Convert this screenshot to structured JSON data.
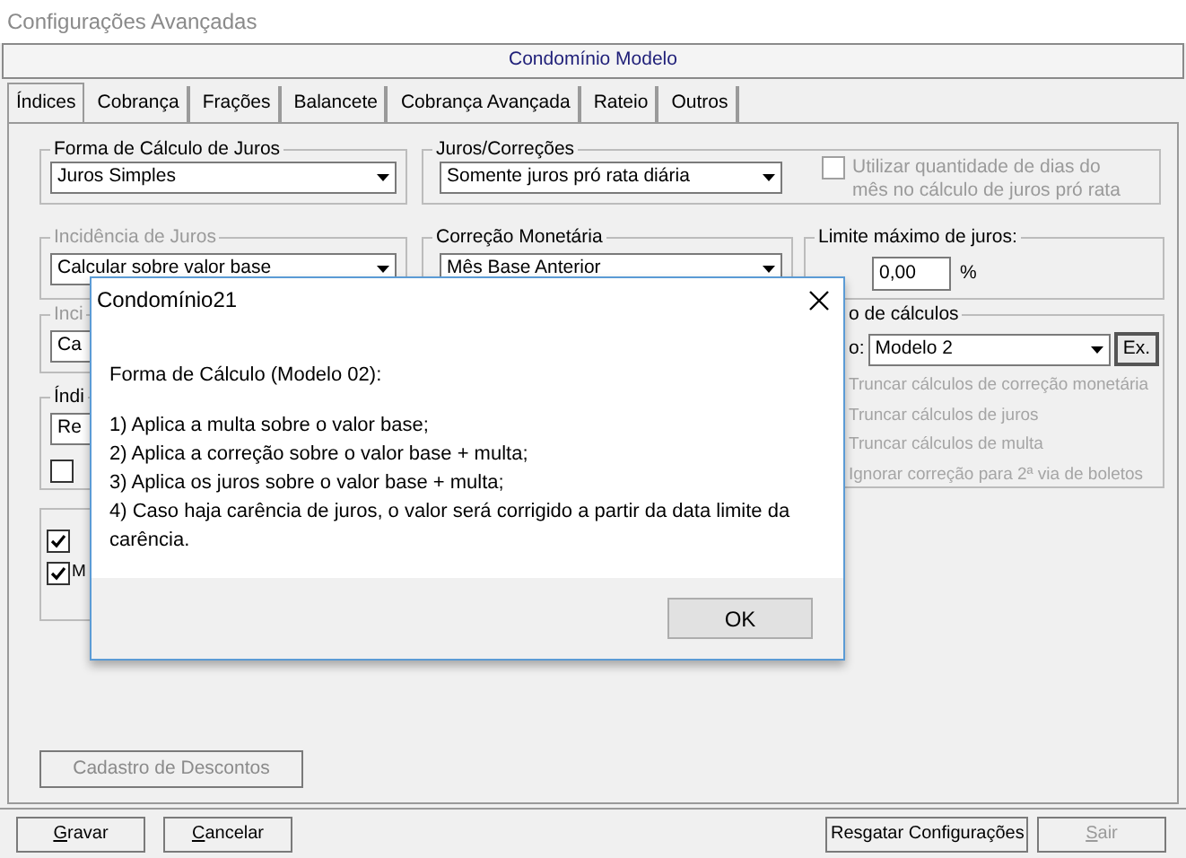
{
  "window": {
    "title": "Configurações Avançadas"
  },
  "header": {
    "title": "Condomínio Modelo"
  },
  "tabs": [
    {
      "label": "Índices",
      "selected": true
    },
    {
      "label": "Cobrança",
      "selected": false
    },
    {
      "label": "Frações",
      "selected": false
    },
    {
      "label": "Balancete",
      "selected": false
    },
    {
      "label": "Cobrança Avançada",
      "selected": false
    },
    {
      "label": "Rateio",
      "selected": false
    },
    {
      "label": "Outros",
      "selected": false
    }
  ],
  "forma_calculo_juros": {
    "label": "Forma de Cálculo de Juros",
    "value": "Juros Simples"
  },
  "juros_correcoes": {
    "label": "Juros/Correções",
    "value": "Somente juros pró rata diária",
    "option": {
      "label": "Utilizar quantidade de dias do mês no cálculo de juros pró rata",
      "checked": false,
      "disabled": true
    }
  },
  "incidencia_juros": {
    "label": "Incidência de Juros",
    "disabled": true,
    "value": "Calcular sobre valor base"
  },
  "correcao_monetaria": {
    "label": "Correção Monetária",
    "value": "Mês Base Anterior"
  },
  "limite_juros": {
    "label": "Limite máximo de juros:",
    "value": "0,00",
    "unit": "%"
  },
  "group_3": {
    "label": "Inci",
    "disabled": true,
    "value": "Ca"
  },
  "group_4": {
    "label": "Índi",
    "value": "Re",
    "checkbox": {
      "checked": false
    }
  },
  "group_5": {
    "checkboxes": [
      {
        "checked": true
      },
      {
        "checked": true,
        "label": "M"
      }
    ]
  },
  "calculos": {
    "label": "o de cálculos",
    "field_label": "o:",
    "value": "Modelo 2",
    "button": "Ex.",
    "options": [
      {
        "label": "Truncar cálculos de correção monetária",
        "disabled": true
      },
      {
        "label": "Truncar cálculos de juros",
        "disabled": true
      },
      {
        "label": "Truncar cálculos de multa",
        "disabled": true
      },
      {
        "label": "Ignorar correção para 2ª via de boletos",
        "disabled": true
      }
    ]
  },
  "discounts_button": {
    "label": "Cadastro de Descontos",
    "disabled": true
  },
  "footer_buttons": [
    {
      "label": "Gravar",
      "mnemonic": true,
      "disabled": false
    },
    {
      "label": "Cancelar",
      "mnemonic": true,
      "disabled": false
    },
    {
      "label": "Resgatar Configurações",
      "mnemonic": false,
      "disabled": false
    },
    {
      "label": "Sair",
      "mnemonic": true,
      "disabled": true
    }
  ],
  "dialog": {
    "title": "Condomínio21",
    "heading": "Forma de Cálculo (Modelo 02):",
    "lines": [
      "1) Aplica a multa sobre o valor base;",
      "2) Aplica a correção sobre o valor base + multa;",
      "3) Aplica os juros sobre o valor base + multa;",
      "4) Caso haja carência de juros, o valor será corrigido a partir da data limite da carência."
    ],
    "button": "OK"
  }
}
